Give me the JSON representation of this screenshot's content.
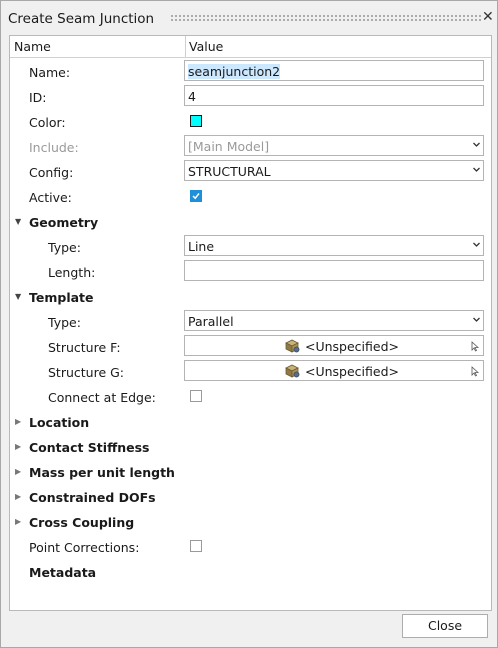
{
  "dialog": {
    "title": "Create Seam Junction",
    "close_label": "Close"
  },
  "header": {
    "name": "Name",
    "value": "Value"
  },
  "rows": {
    "name": {
      "label": "Name:",
      "value": "seamjunction2"
    },
    "id": {
      "label": "ID:",
      "value": "4"
    },
    "color": {
      "label": "Color:",
      "swatch": "#00ffff"
    },
    "include": {
      "label": "Include:",
      "value": "[Main Model]"
    },
    "config": {
      "label": "Config:",
      "value": "STRUCTURAL"
    },
    "active": {
      "label": "Active:",
      "checked": true
    },
    "geometry": {
      "label": "Geometry"
    },
    "geom_type": {
      "label": "Type:",
      "value": "Line"
    },
    "length": {
      "label": "Length:",
      "value": ""
    },
    "template": {
      "label": "Template"
    },
    "tmpl_type": {
      "label": "Type:",
      "value": "Parallel"
    },
    "structure_f": {
      "label": "Structure F:",
      "value": "<Unspecified>"
    },
    "structure_g": {
      "label": "Structure G:",
      "value": "<Unspecified>"
    },
    "connect_edge": {
      "label": "Connect at Edge:",
      "checked": false
    },
    "location": {
      "label": "Location"
    },
    "contact_stiffness": {
      "label": "Contact Stiffness"
    },
    "mass_per_unit": {
      "label": "Mass per unit length"
    },
    "constrained_dofs": {
      "label": "Constrained DOFs"
    },
    "cross_coupling": {
      "label": "Cross Coupling"
    },
    "point_corrections": {
      "label": "Point Corrections:",
      "checked": false
    },
    "metadata": {
      "label": "Metadata"
    }
  }
}
